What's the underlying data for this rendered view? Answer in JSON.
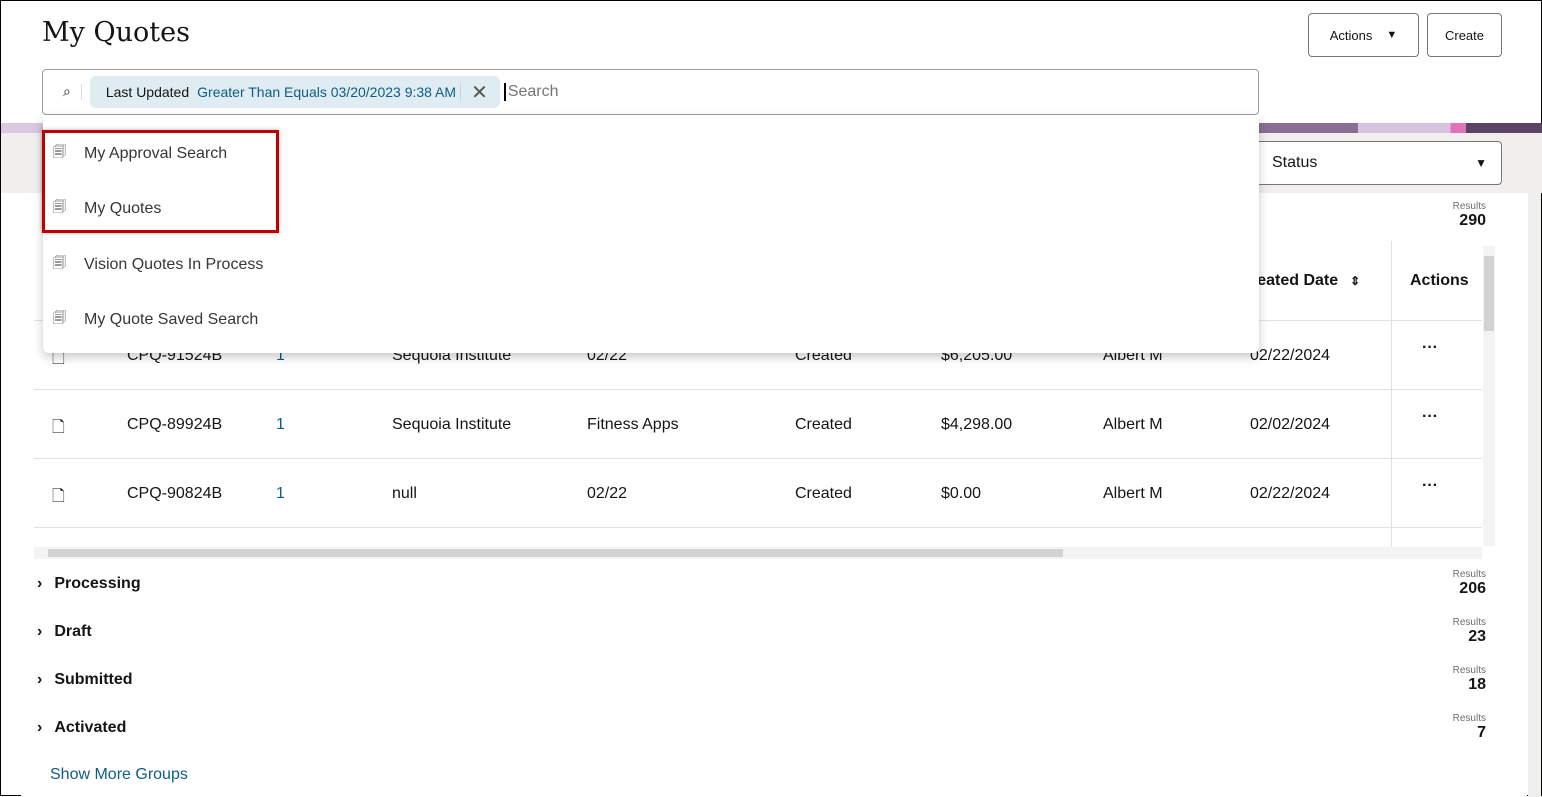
{
  "header": {
    "title": "My Quotes",
    "actions_label": "Actions",
    "create_label": "Create"
  },
  "search": {
    "chip_field": "Last Updated",
    "chip_value": "Greater Than Equals 03/20/2023 9:38 AM",
    "placeholder": "Search"
  },
  "saved_searches": [
    {
      "label": "My Approval Search",
      "highlighted": true
    },
    {
      "label": "My Quotes",
      "highlighted": true
    },
    {
      "label": "Vision Quotes In Process",
      "highlighted": false
    },
    {
      "label": "My Quote Saved Search",
      "highlighted": false
    }
  ],
  "filter": {
    "status_label": "Status"
  },
  "table": {
    "results_label": "Results",
    "results_count": "290",
    "headers": {
      "created_date": "reated Date",
      "actions": "Actions"
    },
    "rows": [
      {
        "number": "CPQ-91524B",
        "version": "1",
        "account": "Sequoia Institute",
        "name": "02/22",
        "status": "Created",
        "amount": "$6,205.00",
        "owner": "Albert M",
        "created": "02/22/2024"
      },
      {
        "number": "CPQ-89924B",
        "version": "1",
        "account": "Sequoia Institute",
        "name": "Fitness Apps",
        "status": "Created",
        "amount": "$4,298.00",
        "owner": "Albert M",
        "created": "02/02/2024"
      },
      {
        "number": "CPQ-90824B",
        "version": "1",
        "account": "null",
        "name": "02/22",
        "status": "Created",
        "amount": "$0.00",
        "owner": "Albert M",
        "created": "02/22/2024"
      }
    ],
    "row_menu": "···"
  },
  "groups": [
    {
      "label": "Processing",
      "results_label": "Results",
      "count": "206"
    },
    {
      "label": "Draft",
      "results_label": "Results",
      "count": "23"
    },
    {
      "label": "Submitted",
      "results_label": "Results",
      "count": "18"
    },
    {
      "label": "Activated",
      "results_label": "Results",
      "count": "7"
    }
  ],
  "show_more": "Show More Groups"
}
